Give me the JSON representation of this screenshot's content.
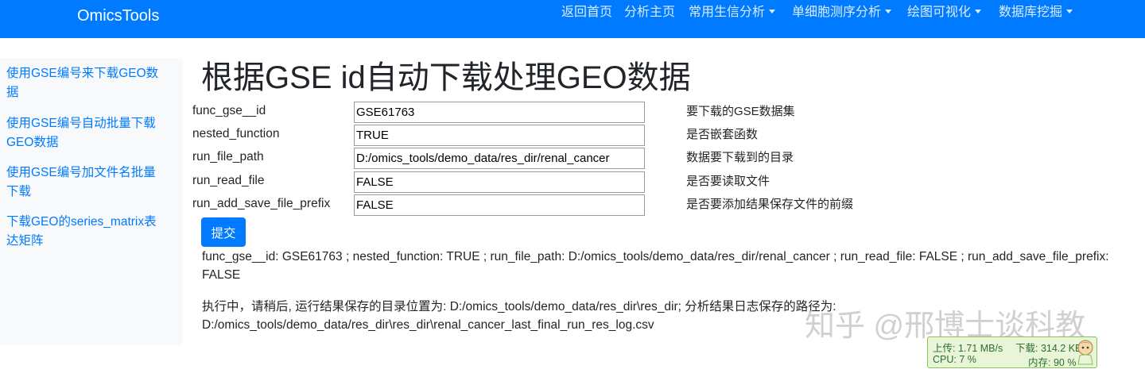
{
  "navbar": {
    "brand": "OmicsTools",
    "items": [
      {
        "label": "返回首页",
        "dropdown": false
      },
      {
        "label": "分析主页",
        "dropdown": false
      },
      {
        "label": "常用生信分析",
        "dropdown": true
      },
      {
        "label": "单细胞测序分析",
        "dropdown": true
      },
      {
        "label": "绘图可视化",
        "dropdown": true
      },
      {
        "label": "数据库挖掘",
        "dropdown": true
      }
    ]
  },
  "sidebar": {
    "links": [
      "使用GSE编号来下载GEO数据",
      "使用GSE编号自动批量下载GEO数据",
      "使用GSE编号加文件名批量下载",
      "下载GEO的series_matrix表达矩阵"
    ]
  },
  "main": {
    "title": "根据GSE id自动下载处理GEO数据",
    "params": [
      {
        "name": "func_gse__id",
        "value": "GSE61763",
        "desc": "要下载的GSE数据集"
      },
      {
        "name": "nested_function",
        "value": "TRUE",
        "desc": "是否嵌套函数"
      },
      {
        "name": "run_file_path",
        "value": "D:/omics_tools/demo_data/res_dir/renal_cancer",
        "desc": "数据要下载到的目录"
      },
      {
        "name": "run_read_file",
        "value": "FALSE",
        "desc": "是否要读取文件"
      },
      {
        "name": "run_add_save_file_prefix",
        "value": "FALSE",
        "desc": "是否要添加结果保存文件的前缀"
      }
    ],
    "submit_label": "提交",
    "summary_line1": "func_gse__id: GSE61763 ; nested_function: TRUE ; run_file_path: D:/omics_tools/demo_data/res_dir/renal_cancer ; run_read_file: FALSE ; run_add_save_file_prefix:",
    "summary_line2": "FALSE",
    "status_line1": "执行中，请稍后, 运行结果保存的目录位置为: D:/omics_tools/demo_data/res_dir\\res_dir; 分析结果日志保存的路径为:",
    "status_line2": "D:/omics_tools/demo_data/res_dir\\res_dir\\renal_cancer_last_final_run_res_log.csv"
  },
  "overlay": {
    "watermark": "知乎 @邢博士谈科教",
    "upload": "上传: 1.71 MB/s",
    "download": "下载: 314.2 KB/s",
    "cpu": "CPU: 7 %",
    "memory": "内存: 90 %"
  },
  "colors": {
    "primary": "#007bff",
    "sidebar_bg": "#f8f9fa",
    "text": "#212529"
  }
}
